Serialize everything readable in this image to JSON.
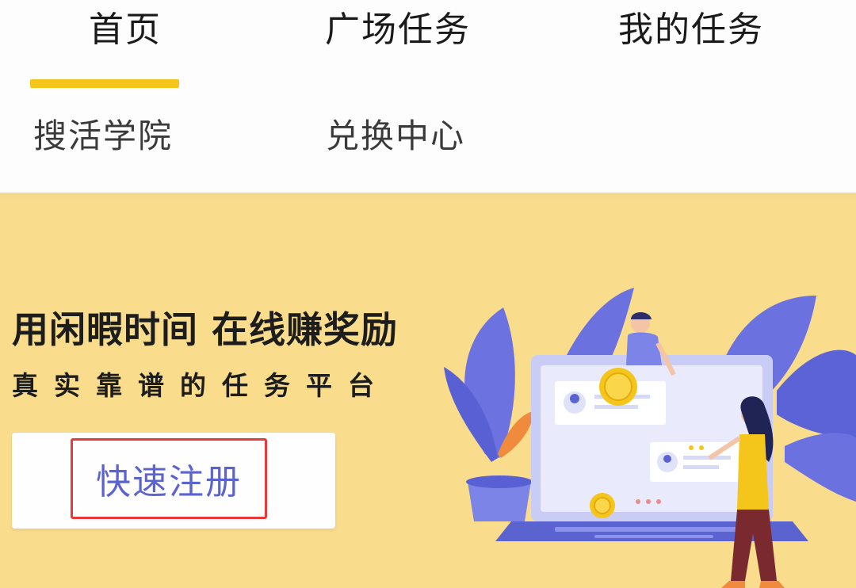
{
  "nav": {
    "tabs": [
      {
        "label": "首页",
        "active": true
      },
      {
        "label": "广场任务"
      },
      {
        "label": "我的任务"
      },
      {
        "label": "搜活学院"
      },
      {
        "label": "兑换中心"
      }
    ],
    "active_indicator_color": "#f4c51a"
  },
  "banner": {
    "headline": "用闲暇时间 在线赚奖励",
    "subline": "真实靠谱的任务平台",
    "register_label": "快速注册",
    "background_color": "#f9dc8c",
    "accent_color": "#5b63d1",
    "highlight_border_color": "#e8393b",
    "illustration": "laptop-with-people-and-coins"
  }
}
